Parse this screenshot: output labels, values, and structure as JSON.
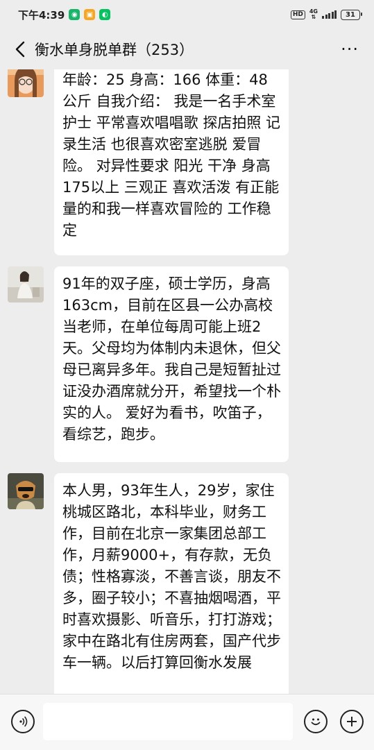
{
  "status": {
    "time": "下午4:39",
    "hd": "HD",
    "network": "4G",
    "battery": "31"
  },
  "header": {
    "title": "衡水单身脱单群（253）",
    "more": "···"
  },
  "messages": [
    {
      "text": "年龄：25 身高：166 体重：48公斤 自我介绍： 我是一名手术室护士 平常喜欢唱唱歌 探店拍照 记录生活 也很喜欢密室逃脱 爱冒险。 对异性要求 阳光 干净 身高175以上 三观正 喜欢活泼 有正能量的和我一样喜欢冒险的 工作稳定"
    },
    {
      "text": "91年的双子座，硕士学历，身高163cm，目前在区县一公办高校当老师，在单位每周可能上班2天。父母均为体制内未退休，但父母已离异多年。我自己是短暂扯过证没办酒席就分开，希望找一个朴实的人。 爱好为看书，吹笛子，看综艺，跑步。"
    },
    {
      "text": "本人男，93年生人，29岁，家住桃城区路北，本科毕业，财务工作，目前在北京一家集团总部工作，月薪9000+，有存款，无负债；性格寡淡，不善言谈，朋友不多，圈子较小；不喜抽烟喝酒，平时喜欢摄影、听音乐，打打游戏；家中在路北有住房两套，国产代步车一辆。以后打算回衡水发展"
    }
  ],
  "colors": {
    "background": "#ededed",
    "bubble": "#ffffff",
    "wechat_green": "#07c160"
  },
  "icons": [
    "back-arrow-icon",
    "more-icon",
    "voice-icon",
    "emoji-icon",
    "plus-icon"
  ]
}
